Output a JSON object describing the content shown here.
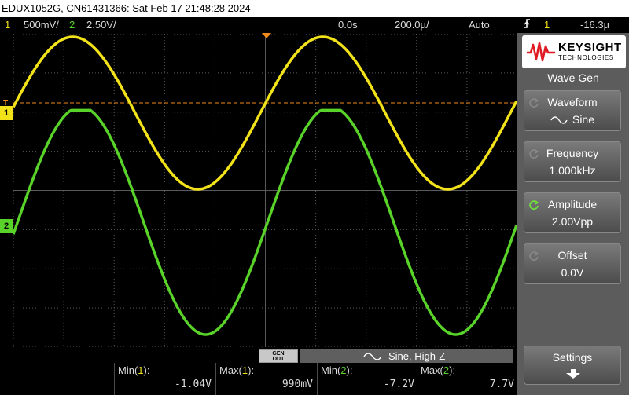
{
  "title_bar": "EDUX1052G, CN61431366: Sat Feb 17 21:48:28 2024",
  "status": {
    "ch1_num": "1",
    "ch1_scale": "500&#x2033;/",
    "ch1_scale_text": "500mV/",
    "ch2_num": "2",
    "ch2_scale": "2.50V/",
    "delay": "0.0s",
    "timebase": "200.0µ/",
    "trigger_mode": "Auto",
    "trigger_icon": "rising-edge",
    "trigger_source": "1",
    "trigger_level": "-16.3µ"
  },
  "markers": {
    "ch1": "1",
    "ch2": "2",
    "trigger": "T"
  },
  "colors": {
    "ch1": "#f2e21a",
    "ch2": "#59d32a",
    "trigger": "#f28a1a",
    "grid": "#5a5a5a"
  },
  "logo": {
    "brand": "KEYSIGHT",
    "sub": "TECHNOLOGIES"
  },
  "menu": {
    "title": "Wave Gen",
    "softkeys": [
      {
        "label": "Waveform",
        "value": "Sine"
      },
      {
        "label": "Frequency",
        "value": "1.000kHz"
      },
      {
        "label": "Amplitude",
        "value": "2.00Vpp"
      },
      {
        "label": "Offset",
        "value": "0.0V"
      },
      {
        "label": "Settings",
        "value": ""
      }
    ]
  },
  "gen_out": {
    "badge_top": "GEN",
    "badge_bottom": "OUT",
    "text": "Sine, High-Z"
  },
  "measurements": [
    {
      "label": "Min(1):",
      "value": "-1.04V"
    },
    {
      "label": "Max(1):",
      "value": "990mV"
    },
    {
      "label": "Min(2):",
      "value": "-7.2V"
    },
    {
      "label": "Max(2):",
      "value": "7.7V"
    }
  ]
}
